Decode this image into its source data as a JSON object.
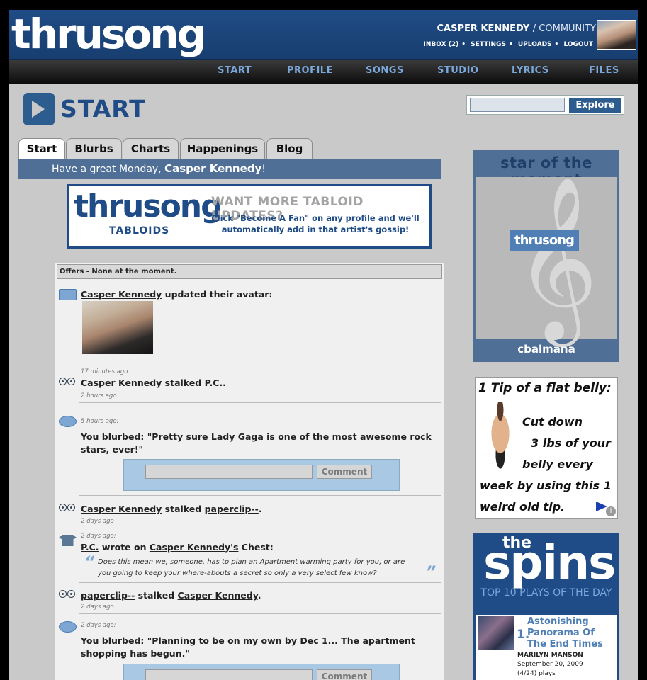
{
  "header": {
    "logo": "thrusong",
    "user_name": "CASPER KENNEDY",
    "community": "/ COMMUNITY",
    "links": [
      "INBOX (2)",
      "SETTINGS",
      "UPLOADS",
      "LOGOUT"
    ]
  },
  "nav": [
    "START",
    "PROFILE",
    "SONGS",
    "STUDIO",
    "LYRICS",
    "FILES"
  ],
  "page": {
    "title": "START",
    "search_button": "Explore",
    "tabs": [
      "Start",
      "Blurbs",
      "Charts",
      "Happenings",
      "Blog"
    ],
    "greeting_prefix": "Have a great Monday,",
    "greeting_name": "Casper Kennedy",
    "greeting_suffix": "!"
  },
  "tabloid_banner": {
    "logo": "thrusong",
    "sub": "TABLOIDS",
    "headline": "WANT MORE TABLOID UPDATES?",
    "body": "Click \"Become A Fan\" on any profile and we'll automatically add in that artist's gossip!"
  },
  "feed": {
    "offers": "Offers - None at the moment.",
    "items": [
      {
        "user": "Casper Kennedy",
        "action": "updated their avatar:",
        "time": "17 minutes ago"
      },
      {
        "user": "Casper Kennedy",
        "action": "stalked",
        "target": "P.C.",
        "end": ".",
        "time": "2 hours ago"
      },
      {
        "time": "5 hours ago:",
        "user": "You",
        "action": "blurbed: \"Pretty sure Lady Gaga is one of the most awesome rock stars, ever!\""
      },
      {
        "user": "Casper Kennedy",
        "action": "stalked",
        "target": "paperclip--",
        "end": ".",
        "time": "2 days ago"
      },
      {
        "time": "2 days ago:",
        "user": "P.C.",
        "action": "wrote on",
        "target": "Casper Kennedy's",
        "end": "Chest:",
        "quote": "Does this mean we, someone, has to plan an Apartment warming party for you, or are you going to keep your where-abouts a secret so only a very select few know?"
      },
      {
        "user": "paperclip--",
        "action": "stalked",
        "target": "Casper Kennedy",
        "end": ".",
        "time": "2 days ago"
      },
      {
        "time": "2 days ago:",
        "user": "You",
        "action": "blurbed: \"Planning to be on my own by Dec 1... The apartment shopping has begun.\""
      }
    ],
    "comment_button": "Comment"
  },
  "star": {
    "title": "star of the moment",
    "logo": "thrusong",
    "name": "cbalmana"
  },
  "ad": {
    "line1": "1 Tip of a flat belly:",
    "body": [
      "Cut down",
      "3 lbs of your",
      "belly every"
    ],
    "body2": [
      "week by using this 1",
      "weird old tip."
    ]
  },
  "spins": {
    "the": "the",
    "title": "spins",
    "sub": "TOP 10 PLAYS OF THE DAY",
    "item": {
      "num": "1.",
      "song": "Astonishing Panorama Of The End Times",
      "artist": "MARILYN MANSON",
      "date": "September 20, 2009",
      "plays": "(4/24) plays"
    }
  }
}
